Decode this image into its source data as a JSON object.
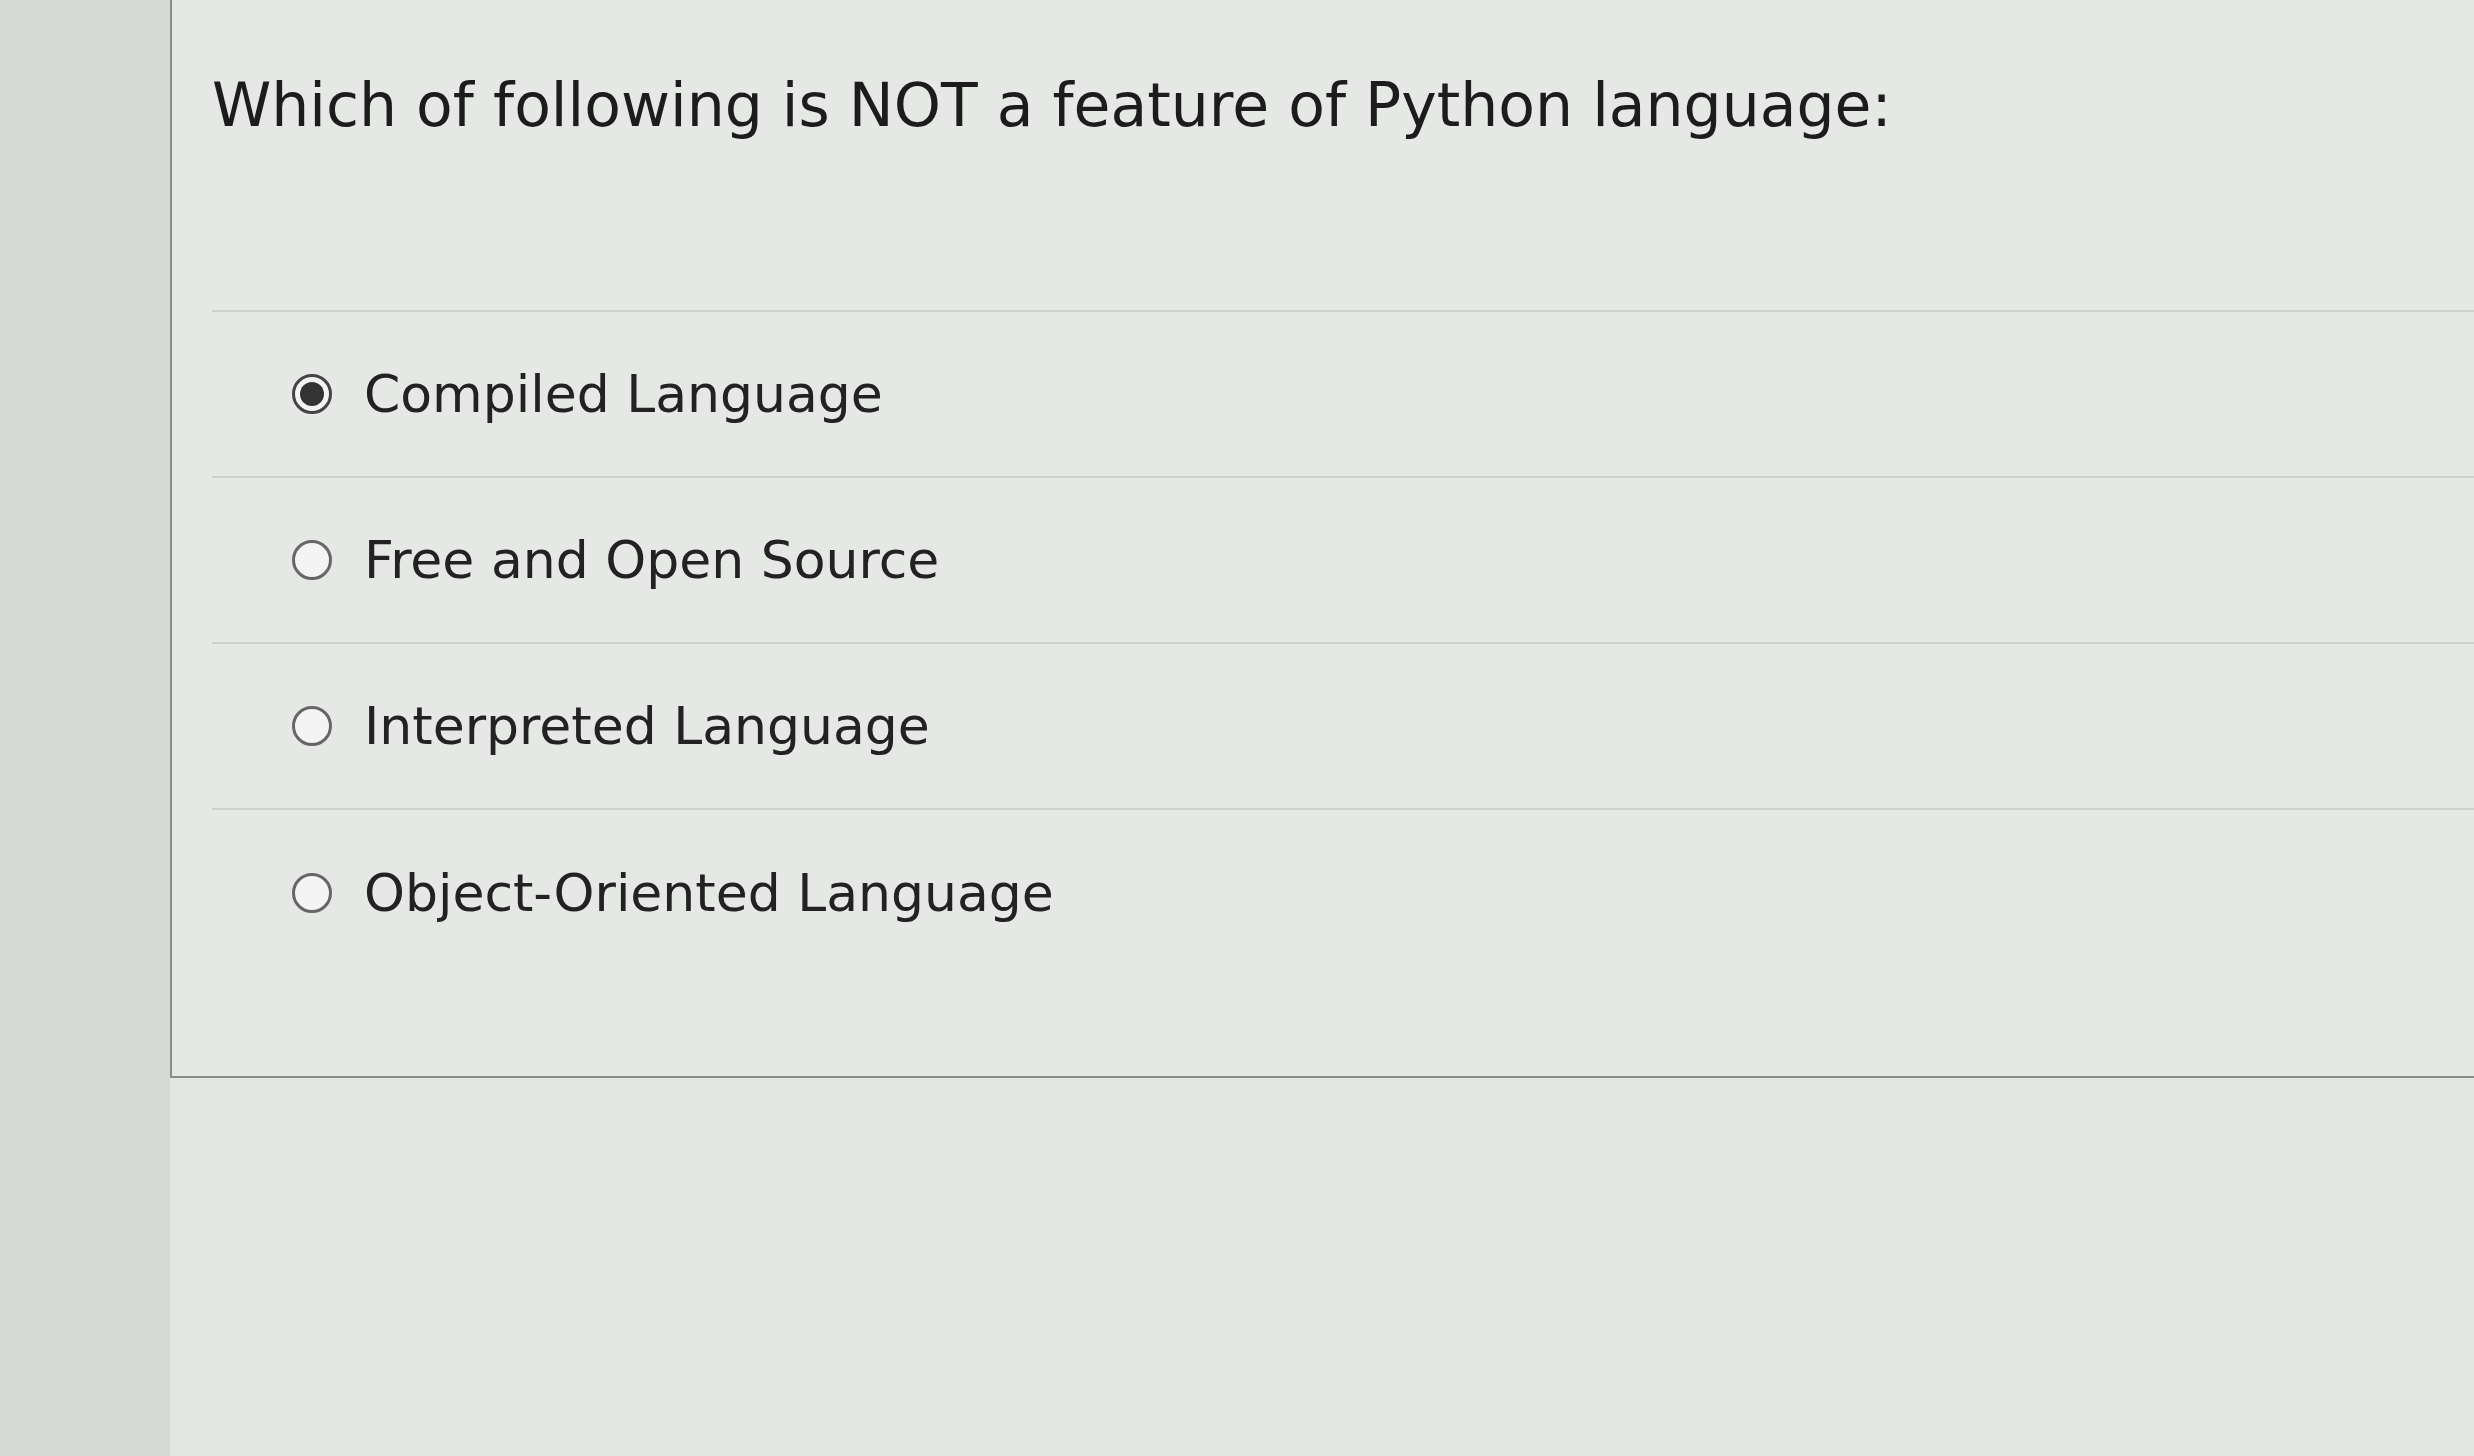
{
  "question": "Which of following is NOT a feature of Python language:",
  "options": [
    {
      "label": "Compiled Language",
      "selected": true
    },
    {
      "label": "Free and Open Source",
      "selected": false
    },
    {
      "label": "Interpreted Language",
      "selected": false
    },
    {
      "label": "Object-Oriented Language",
      "selected": false
    }
  ]
}
